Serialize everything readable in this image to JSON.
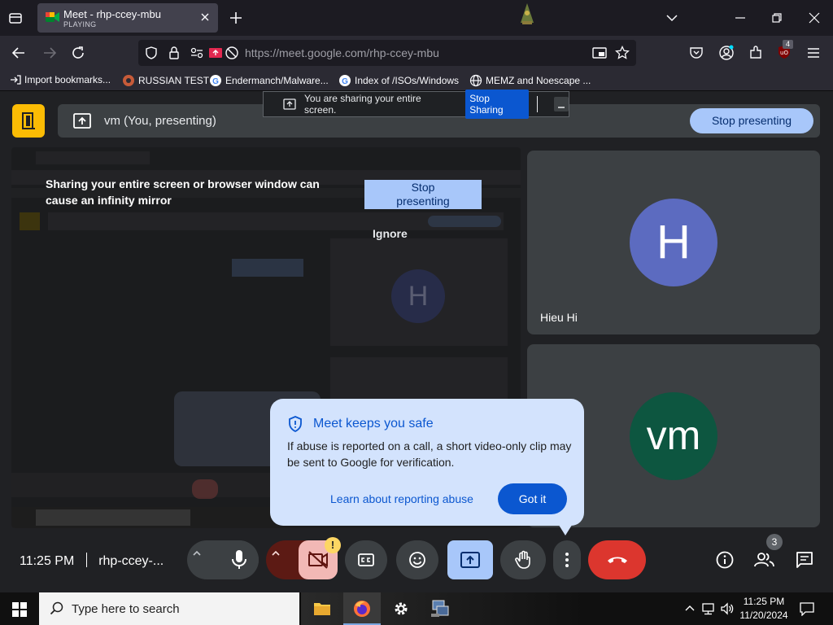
{
  "browser": {
    "tab": {
      "title": "Meet - rhp-ccey-mbu",
      "status": "PLAYING"
    },
    "url": {
      "host": "https://meet.google.com",
      "path": "/rhp-ccey-mbu"
    },
    "extension_badge": "4",
    "bookmarks": [
      {
        "label": "Import bookmarks...",
        "icon": "import-icon"
      },
      {
        "label": "RUSSIAN TEST",
        "icon": "site-favicon"
      },
      {
        "label": "Endermanch/Malware...",
        "icon": "google-icon"
      },
      {
        "label": "Index of /ISOs/Windows",
        "icon": "google-icon"
      },
      {
        "label": "MEMZ and Noescape ...",
        "icon": "globe-icon"
      }
    ]
  },
  "share_notice": {
    "text": "You are sharing your entire screen.",
    "stop_label": "Stop Sharing"
  },
  "meet": {
    "presenting_title": "vm (You, presenting)",
    "stop_presenting": "Stop presenting",
    "mirror_warning": "Sharing your entire screen or browser window can cause an infinity mirror",
    "stop_presenting_mid": "Stop presenting",
    "ignore": "Ignore",
    "participants": [
      {
        "initial": "H",
        "name": "Hieu Hi",
        "color": "#5c6bc0"
      },
      {
        "initial": "vm",
        "name": "",
        "color": "#0d5640"
      }
    ],
    "safety": {
      "title": "Meet keeps you safe",
      "body": "If abuse is reported on a call, a short video-only clip may be sent to Google for verification.",
      "link": "Learn about reporting abuse",
      "button": "Got it"
    },
    "controls": {
      "time": "11:25 PM",
      "meeting_code": "rhp-ccey-...",
      "camera_warning_badge": "!",
      "people_count": "3"
    }
  },
  "taskbar": {
    "search_placeholder": "Type here to search",
    "time": "11:25 PM",
    "date": "11/20/2024"
  },
  "colors": {
    "meet_bg": "#202124",
    "accent_blue": "#0b57d0",
    "light_blue": "#a8c7fa",
    "end_call_red": "#dc362e",
    "presenting_yellow": "#fbbc04"
  }
}
